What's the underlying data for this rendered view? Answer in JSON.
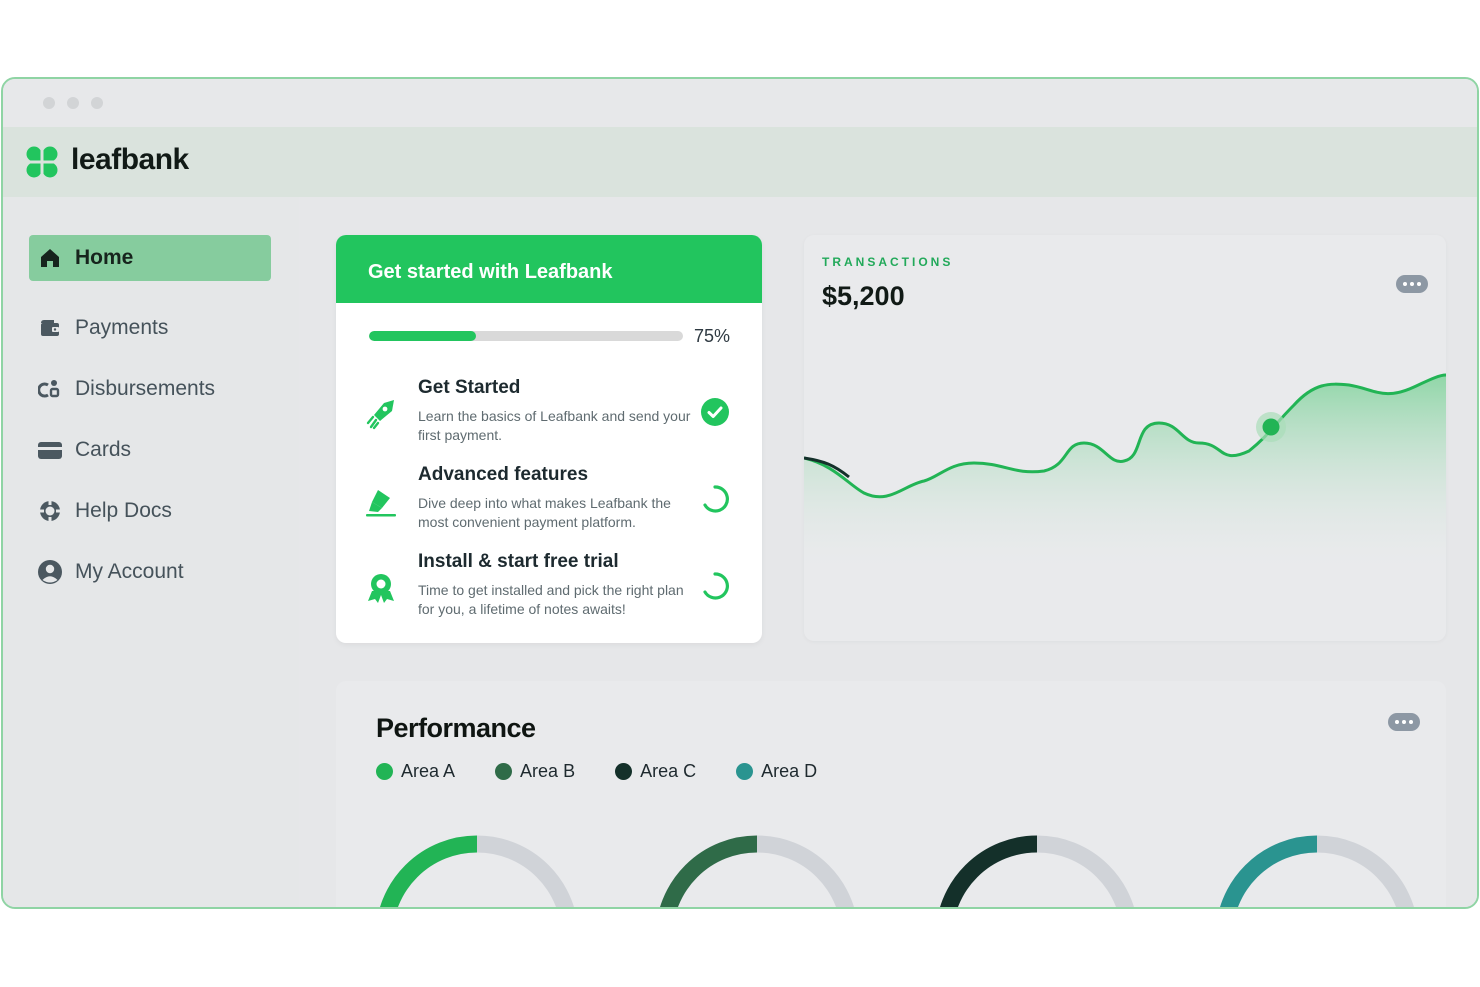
{
  "brand": {
    "name": "leafbank",
    "accent": "#22c55e"
  },
  "sidebar": {
    "items": [
      {
        "label": "Home",
        "icon": "home-icon",
        "active": true
      },
      {
        "label": "Payments",
        "icon": "wallet-icon",
        "active": false
      },
      {
        "label": "Disbursements",
        "icon": "disbursements-icon",
        "active": false
      },
      {
        "label": "Cards",
        "icon": "card-icon",
        "active": false
      },
      {
        "label": "Help Docs",
        "icon": "lifebuoy-icon",
        "active": false
      },
      {
        "label": "My Account",
        "icon": "user-circle-icon",
        "active": false
      }
    ]
  },
  "get_started": {
    "title": "Get started with Leafbank",
    "progress_label": "75%",
    "progress_fraction": 0.34,
    "tasks": [
      {
        "title": "Get Started",
        "desc": "Learn the basics of Leafbank and send your first payment.",
        "icon": "rocket-icon",
        "status": "complete"
      },
      {
        "title": "Advanced features",
        "desc": "Dive deep into what makes Leafbank the most convenient payment platform.",
        "icon": "highlighter-icon",
        "status": "in-progress"
      },
      {
        "title": "Install & start free trial",
        "desc": "Time to get installed and pick the right plan for you, a lifetime of notes awaits!",
        "icon": "badge-icon",
        "status": "in-progress"
      }
    ]
  },
  "transactions": {
    "label": "TRANSACTIONS",
    "value": "$5,200",
    "line_color": "#22c55e"
  },
  "performance": {
    "title": "Performance",
    "legend": [
      {
        "label": "Area A",
        "color": "#22b455"
      },
      {
        "label": "Area B",
        "color": "#2f6b48"
      },
      {
        "label": "Area C",
        "color": "#14302a"
      },
      {
        "label": "Area D",
        "color": "#2a9490"
      }
    ],
    "track_color": "#d0d3d8"
  }
}
